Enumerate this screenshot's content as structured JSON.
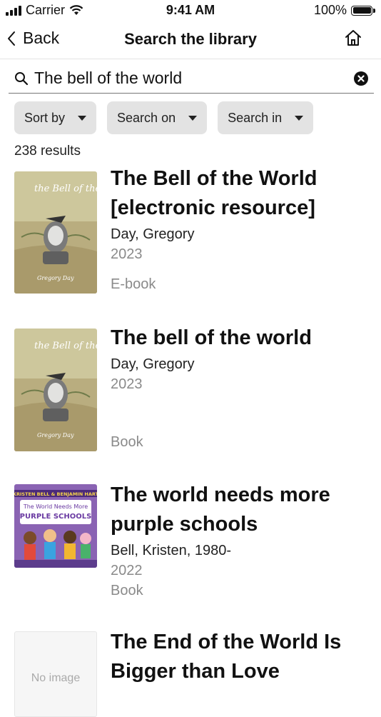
{
  "status_bar": {
    "carrier": "Carrier",
    "time": "9:41 AM",
    "battery": "100%"
  },
  "nav": {
    "back_label": "Back",
    "title": "Search the library"
  },
  "search": {
    "value": "The bell of the world"
  },
  "filters": [
    {
      "label": "Sort by"
    },
    {
      "label": "Search on"
    },
    {
      "label": "Search in"
    }
  ],
  "results_count": "238 results",
  "results": [
    {
      "title": "The Bell of the World [electronic resource]",
      "author": "Day, Gregory",
      "year": "2023",
      "format": "E-book"
    },
    {
      "title": "The bell of the world",
      "author": "Day, Gregory",
      "year": "2023",
      "format": "Book"
    },
    {
      "title": "The world needs more purple schools",
      "author": "Bell, Kristen, 1980-",
      "year": "2022",
      "format": "Book"
    },
    {
      "title": "The End of the World Is Bigger than Love",
      "cover_text": "No image"
    }
  ],
  "covers": {
    "bell_title": "the Bell of the World",
    "bell_author": "Gregory Day",
    "purple_authors": "KRISTEN BELL & BENJAMIN HART",
    "purple_title_1": "The World Needs More",
    "purple_title_2": "PURPLE SCHOOLS"
  },
  "colors": {
    "cover_bell_bg": "#c9c39a",
    "cover_purple_bg": "#8a63b3",
    "muted_text": "#8a8a8a",
    "chip_bg": "#e3e3e3"
  }
}
